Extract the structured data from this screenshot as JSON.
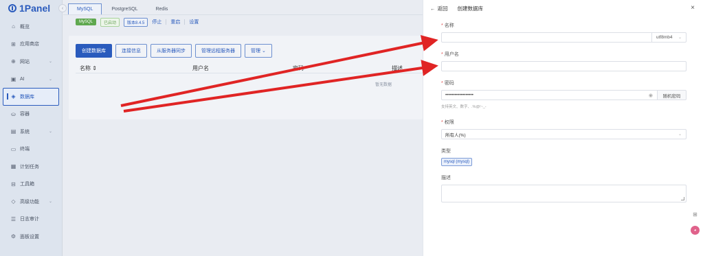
{
  "brand": {
    "name": "1Panel",
    "collapse_icon": "chevron-left-icon"
  },
  "sidebar": {
    "items": [
      {
        "label": "概览",
        "icon": "home-icon",
        "has_children": false
      },
      {
        "label": "应用商店",
        "icon": "grid-icon",
        "has_children": false
      },
      {
        "label": "网站",
        "icon": "globe-icon",
        "has_children": true
      },
      {
        "label": "AI",
        "icon": "robot-icon",
        "has_children": true
      },
      {
        "label": "数据库",
        "icon": "database-icon",
        "has_children": false,
        "active": true
      },
      {
        "label": "容器",
        "icon": "container-icon",
        "has_children": false
      },
      {
        "label": "系统",
        "icon": "system-icon",
        "has_children": true
      },
      {
        "label": "终端",
        "icon": "terminal-icon",
        "has_children": false
      },
      {
        "label": "计划任务",
        "icon": "calendar-icon",
        "has_children": false
      },
      {
        "label": "工具箱",
        "icon": "toolbox-icon",
        "has_children": false
      },
      {
        "label": "高级功能",
        "icon": "diamond-icon",
        "has_children": true
      },
      {
        "label": "日志审计",
        "icon": "log-icon",
        "has_children": false
      },
      {
        "label": "面板设置",
        "icon": "gear-icon",
        "has_children": false
      }
    ]
  },
  "main": {
    "tabs": [
      {
        "label": "MySQL",
        "active": true
      },
      {
        "label": "PostgreSQL",
        "active": false
      },
      {
        "label": "Redis",
        "active": false
      }
    ],
    "status": {
      "app": "MySQL",
      "state": "已启动",
      "version": "版本8.4.5",
      "actions": [
        "停止",
        "重启",
        "设置"
      ]
    },
    "buttons": {
      "create": "创建数据库",
      "connect": "连接信息",
      "sync": "从服务器同步",
      "remote": "管理远程服务器",
      "manage": "管理"
    },
    "table": {
      "columns": [
        "名称",
        "用户名",
        "密码",
        "描述"
      ],
      "empty_text": "暂无数据"
    }
  },
  "drawer": {
    "back_label": "返回",
    "title": "创建数据库",
    "fields": {
      "name_label": "名称",
      "name_value": "",
      "charset": "utf8mb4",
      "username_label": "用户名",
      "username_value": "",
      "password_label": "密码",
      "password_value": "••••••••••••••••••",
      "random_password": "随机密码",
      "password_hint": "支持英文、数字、.%@!~_-",
      "permission_label": "权限",
      "permission_value": "所有人(%)",
      "type_label": "类型",
      "type_value": "mysql (mysql)",
      "description_label": "描述",
      "description_value": ""
    }
  },
  "annotation_color": "#e02424"
}
